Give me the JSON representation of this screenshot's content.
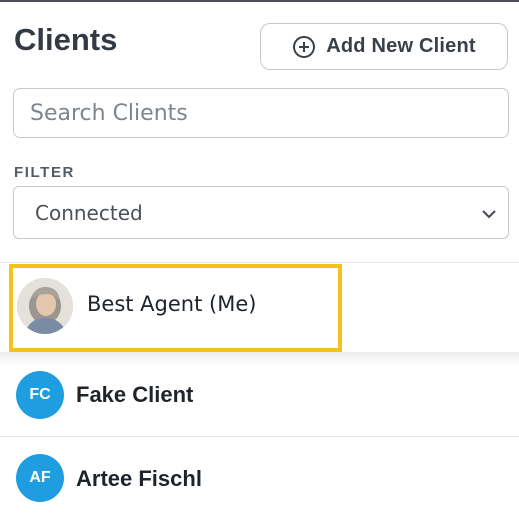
{
  "header": {
    "title": "Clients",
    "add_button_label": "Add New Client",
    "add_icon": "plus-circle-icon"
  },
  "search": {
    "placeholder": "Search Clients",
    "value": ""
  },
  "filter": {
    "label": "FILTER",
    "selected": "Connected",
    "chevron_icon": "chevron-down-icon"
  },
  "clients": [
    {
      "name": "Best Agent (Me)",
      "avatar": "photo",
      "highlighted": true
    },
    {
      "name": "Fake Client",
      "initials": "FC"
    },
    {
      "name": "Artee Fischl",
      "initials": "AF"
    }
  ],
  "colors": {
    "accent_blue": "#1e9ee0",
    "highlight_yellow": "#f3c21b",
    "title": "#333a44"
  }
}
